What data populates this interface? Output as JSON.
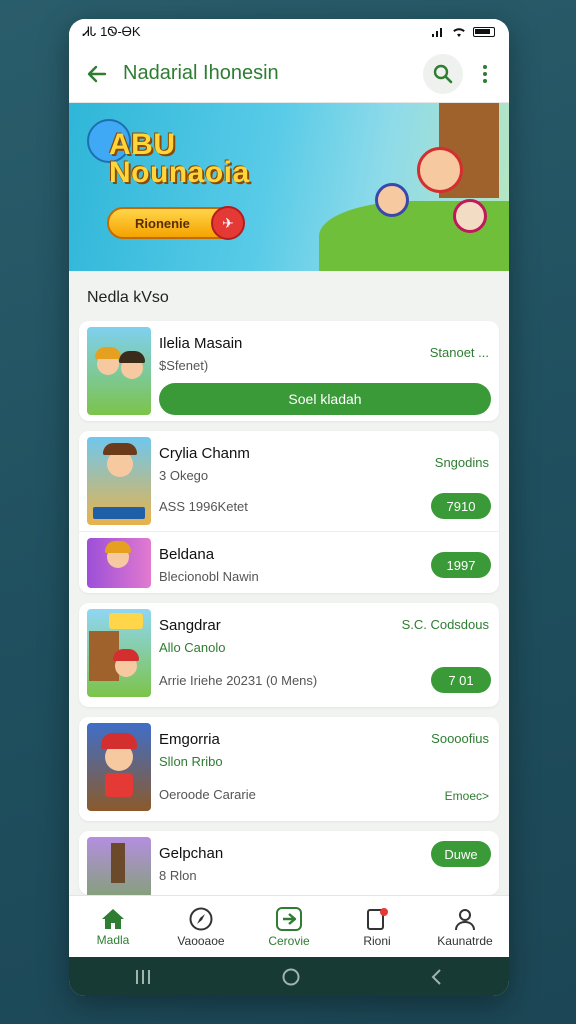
{
  "status_bar": {
    "time": "ᏗᏓ 1Ꮻ-ᎾK"
  },
  "app_bar": {
    "title": "Nadarial Ihonesin"
  },
  "banner": {
    "title_line1": "ABU",
    "title_line2": "Nounaoia",
    "button_label": "Rionenie"
  },
  "section": {
    "title": "Nedla kVso"
  },
  "cards": [
    {
      "rows": [
        {
          "name": "Ilelia Masain",
          "sub": "$Sfenet)",
          "status": "Stanoet ...",
          "button": "Soel kladah"
        }
      ]
    },
    {
      "rows": [
        {
          "name": "Crylia Chanm",
          "sub": "3 Okego",
          "meta": "ASS 1996Ketet",
          "status": "Sngodins",
          "pill": "7910"
        },
        {
          "name": "Beldana",
          "sub": "Blecionobl Nawin",
          "pill": "1997"
        }
      ]
    },
    {
      "rows": [
        {
          "name": "Sangdrar",
          "sub": "Allo Canolo",
          "meta": "Arrie Iriehe 20231 (0 Mens)",
          "status": "S.C. Codsdous",
          "pill": "7 01"
        }
      ]
    },
    {
      "rows": [
        {
          "name": "Emgorria",
          "sub": "Sllon Rribo",
          "meta": "Oeroode Cararie",
          "status": "Soooofius",
          "link": "Emoec>"
        }
      ]
    },
    {
      "rows": [
        {
          "name": "Gelpchan",
          "sub": "8 Rlon",
          "pill": "Duwe"
        }
      ]
    }
  ],
  "bottom_nav": [
    {
      "label": "Madla",
      "icon": "home-icon"
    },
    {
      "label": "Vaooaoe",
      "icon": "compass-icon"
    },
    {
      "label": "Cerovie",
      "icon": "games-icon"
    },
    {
      "label": "Rioni",
      "icon": "notification-icon"
    },
    {
      "label": "Kaunatrde",
      "icon": "profile-icon"
    }
  ],
  "colors": {
    "primary": "#2e7d32",
    "button": "#3a9a37",
    "background": "#f1f3f1"
  }
}
